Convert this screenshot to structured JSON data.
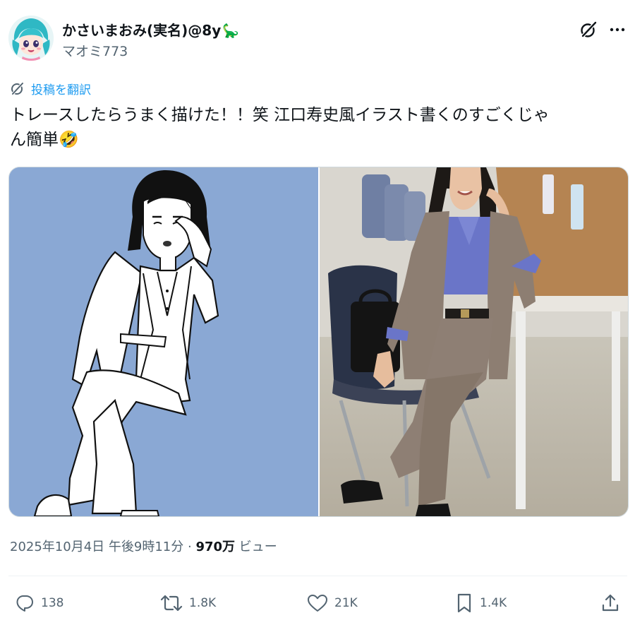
{
  "author": {
    "display_name": "かさいまおみ(実名)@8y",
    "name_emoji": "🦕",
    "handle": "マオミ773"
  },
  "translate_label": "投稿を翻訳",
  "tweet": {
    "text_line1": "トレースしたらうまく描けた！！笑 江口寿史風イラスト書くのすごくじゃ",
    "text_line2": "ん簡単",
    "text_emoji": "🤣"
  },
  "meta": {
    "timestamp": "2025年10月4日 午後9時11分",
    "separator": "·",
    "views_count": "970万",
    "views_label": "ビュー"
  },
  "actions": {
    "replies": "138",
    "reposts": "1.8K",
    "likes": "21K",
    "bookmarks": "1.4K"
  },
  "colors": {
    "text_primary": "#0f1419",
    "text_secondary": "#536471",
    "accent": "#1d9bf0",
    "illustration_bg": "#8aa8d4"
  },
  "icons": {
    "grok": "grok-icon",
    "more": "more-icon",
    "translate": "translate-icon",
    "reply": "reply-icon",
    "repost": "repost-icon",
    "like": "heart-icon",
    "bookmark": "bookmark-icon",
    "share": "share-icon"
  }
}
